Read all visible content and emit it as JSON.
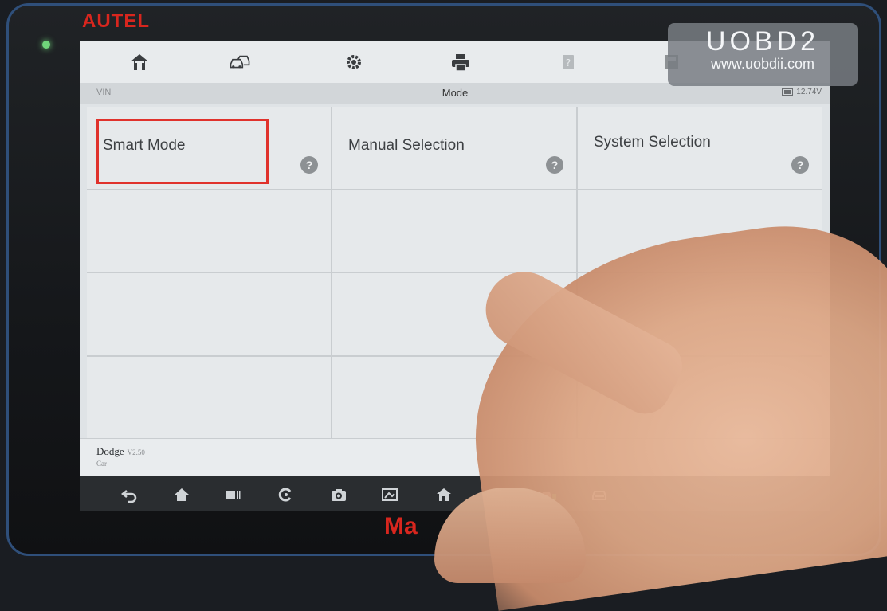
{
  "device": {
    "brand_top": "AUTEL",
    "brand_bottom": "Ma"
  },
  "toolbar": {
    "icons": [
      "home-icon",
      "vehicle-swap-icon",
      "gear-icon",
      "printer-icon",
      "help-icon",
      "save-icon"
    ]
  },
  "status": {
    "vin_label": "VIN",
    "title": "Mode",
    "battery": "12.74V"
  },
  "modes": [
    {
      "label": "Smart Mode",
      "help": "?",
      "selected": true
    },
    {
      "label": "Manual Selection",
      "help": "?",
      "selected": false
    },
    {
      "label": "System Selection",
      "help": "?",
      "selected": false
    }
  ],
  "vehicle": {
    "make": "Dodge",
    "version": "V2.50",
    "type": "Car"
  },
  "navbar": {
    "icons": [
      "back-icon",
      "android-home-icon",
      "recent-apps-icon",
      "browser-icon",
      "camera-icon",
      "display-icon",
      "maxisys-home-icon",
      "vci-icon",
      "vehicle-connect-icon",
      "car-icon"
    ]
  },
  "watermark": {
    "title": "UOBD2",
    "url": "www.uobdii.com"
  },
  "colors": {
    "highlight": "#e0322c",
    "brand": "#d8261e"
  }
}
